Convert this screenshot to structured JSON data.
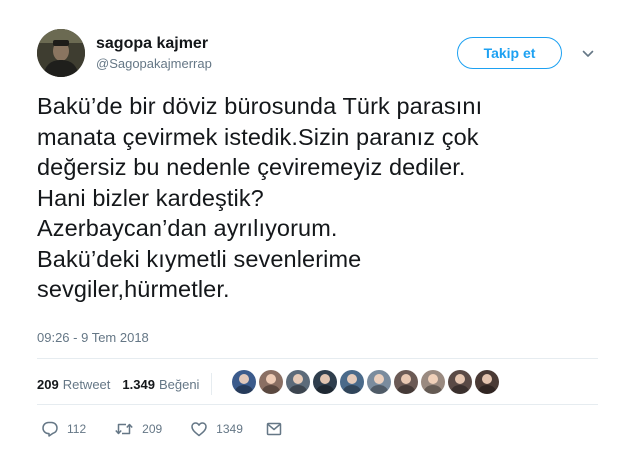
{
  "author": {
    "name": "sagopa kajmer",
    "handle": "@Sagopakajmerrap"
  },
  "follow_button": {
    "label": "Takip et"
  },
  "tweet": {
    "lines": [
      "Bakü’de bir döviz bürosunda Türk parasını",
      "manata çevirmek istedik.Sizin paranız çok",
      "değersiz bu nedenle çeviremeyiz dediler.",
      "Hani bizler kardeştik?",
      "Azerbaycan’dan ayrılıyorum.",
      "Bakü’deki kıymetli sevenlerime",
      "sevgiler,hürmetler."
    ],
    "timestamp": "09:26 - 9 Tem 2018"
  },
  "stats": {
    "retweet_count": "209",
    "retweet_label": "Retweet",
    "like_count": "1.349",
    "like_label": "Beğeni"
  },
  "likers": [
    "#3b5b8c",
    "#8a6f63",
    "#5c6b7a",
    "#2f3e4d",
    "#4a6a8a",
    "#7a8c9e",
    "#6b5a55",
    "#9a8a80",
    "#5a4a45",
    "#4a3a35"
  ],
  "actions": {
    "reply_count": "112",
    "retweet_count": "209",
    "like_count": "1349"
  },
  "colors": {
    "accent": "#1da1f2",
    "muted": "#657786",
    "text": "#14171a",
    "divider": "#e6ecf0"
  }
}
